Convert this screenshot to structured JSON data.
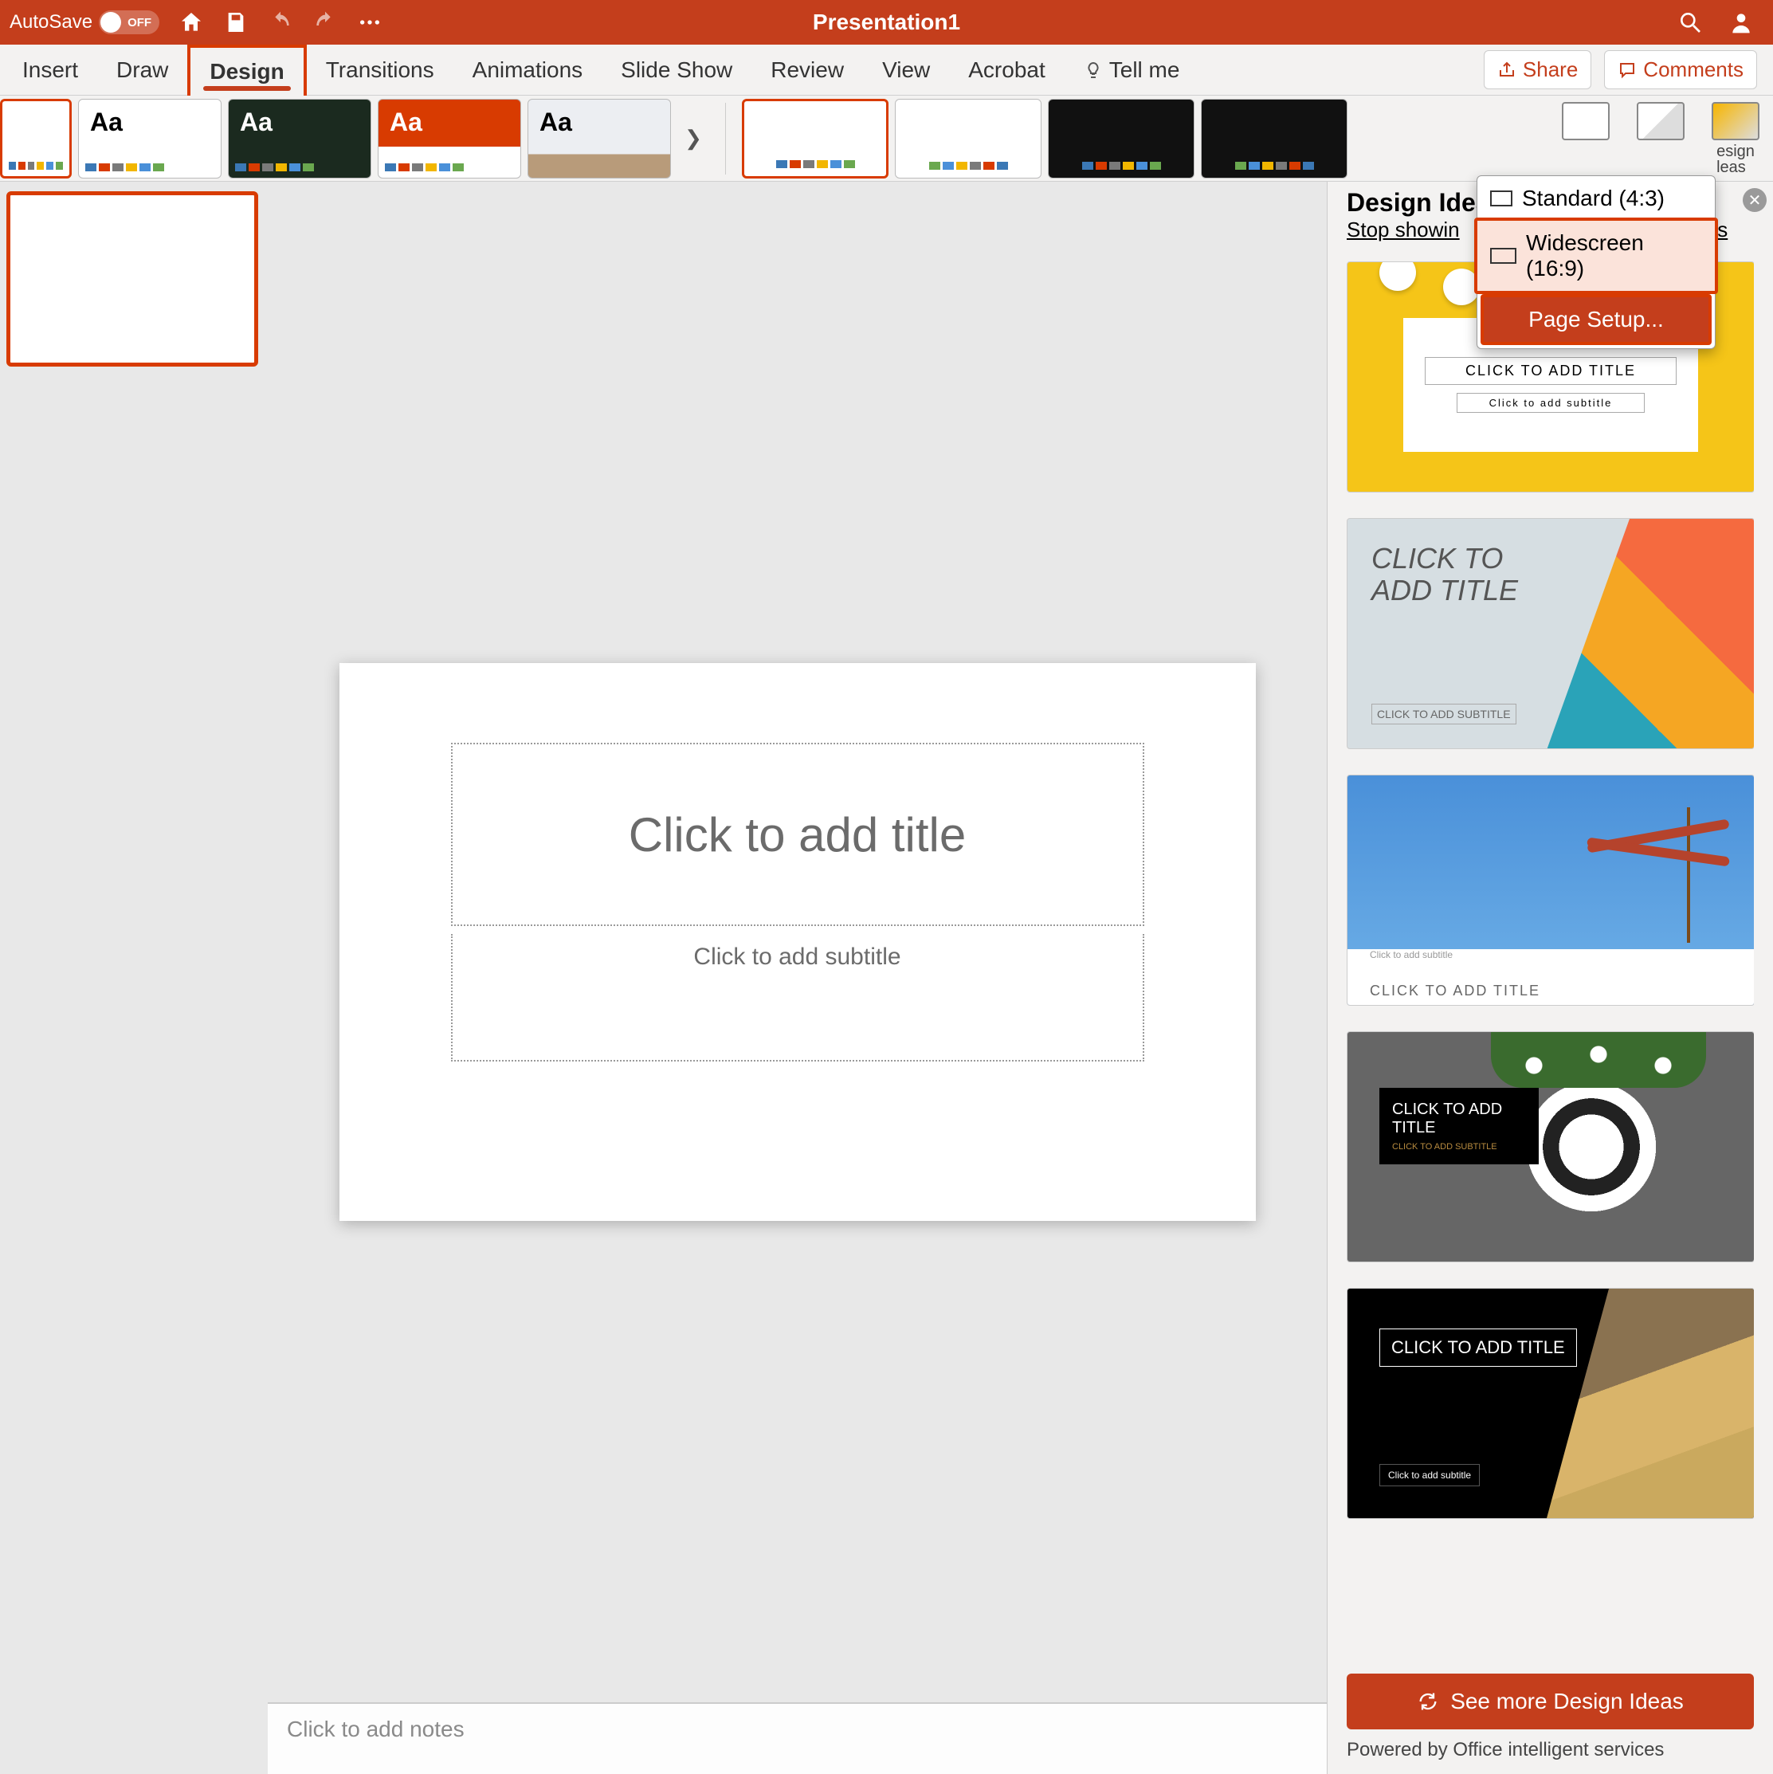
{
  "titlebar": {
    "autosave_label": "AutoSave",
    "autosave_state": "OFF",
    "title": "Presentation1"
  },
  "tabs": {
    "insert": "Insert",
    "draw": "Draw",
    "design": "Design",
    "transitions": "Transitions",
    "animations": "Animations",
    "slide_show": "Slide Show",
    "review": "Review",
    "view": "View",
    "acrobat": "Acrobat",
    "tell_me": "Tell me"
  },
  "actions": {
    "share": "Share",
    "comments": "Comments"
  },
  "ribbon": {
    "design_ideas_label": "esign\nleas",
    "slide_size_menu": {
      "standard": "Standard (4:3)",
      "widescreen": "Widescreen (16:9)",
      "page_setup": "Page Setup..."
    }
  },
  "slide": {
    "title_placeholder": "Click to add title",
    "subtitle_placeholder": "Click to add subtitle"
  },
  "notes": {
    "placeholder": "Click to add notes"
  },
  "pane": {
    "title": "Design Idea",
    "stop_link_prefix": "Stop showin",
    "stop_link_suffix": "ions",
    "see_more": "See more Design Ideas",
    "powered": "Powered by Office intelligent services",
    "ideas": [
      {
        "title": "CLICK TO ADD TITLE",
        "subtitle": "Click to add subtitle"
      },
      {
        "title": "CLICK TO\nADD TITLE",
        "subtitle": "CLICK TO ADD SUBTITLE"
      },
      {
        "title": "CLICK TO ADD TITLE",
        "subtitle": "Click to add subtitle"
      },
      {
        "title": "CLICK TO ADD TITLE",
        "subtitle": "CLICK TO ADD SUBTITLE"
      },
      {
        "title": "CLICK TO ADD TITLE",
        "subtitle": "Click to add subtitle"
      }
    ]
  }
}
